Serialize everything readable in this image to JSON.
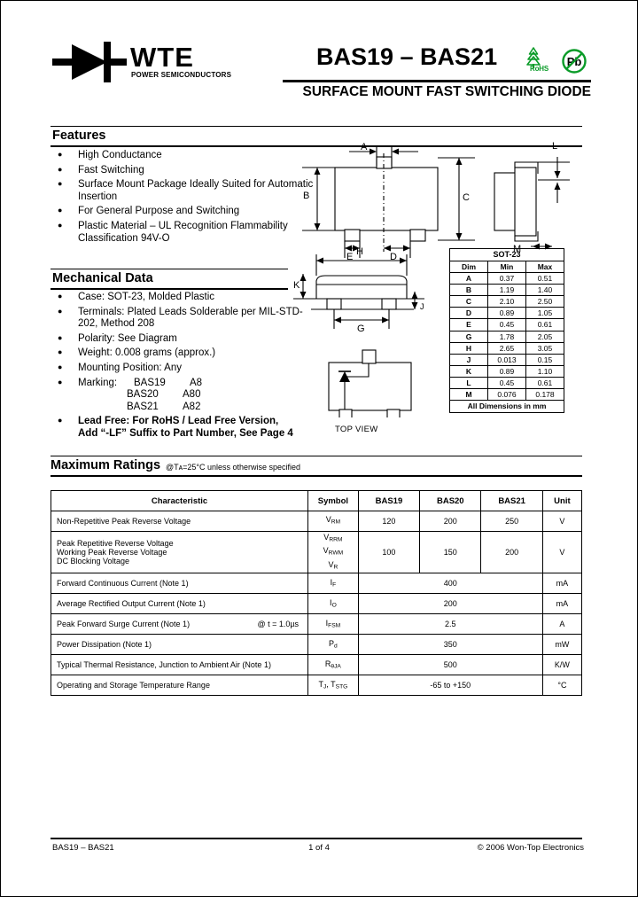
{
  "brand": {
    "name": "WTE",
    "tagline": "POWER SEMICONDUCTORS",
    "logo_icon": "diode-symbol"
  },
  "header": {
    "part_title": "BAS19 – BAS21",
    "subtitle": "SURFACE MOUNT FAST SWITCHING DIODE",
    "rohs_label": "RoHS",
    "pb_label": "Pb",
    "accent_green": "#0a9b28"
  },
  "features": {
    "heading": "Features",
    "items": [
      "High Conductance",
      "Fast Switching",
      "Surface Mount Package Ideally Suited for Automatic Insertion",
      "For General Purpose and Switching",
      "Plastic Material – UL Recognition Flammability Classification 94V-O"
    ]
  },
  "mechanical": {
    "heading": "Mechanical Data",
    "items": [
      "Case: SOT-23, Molded Plastic",
      "Terminals: Plated Leads Solderable per MIL-STD-202, Method 208",
      "Polarity: See Diagram",
      "Weight: 0.008 grams (approx.)",
      "Mounting Position: Any"
    ],
    "marking_label": "Marking:",
    "markings": [
      {
        "part": "BAS19",
        "code": "A8"
      },
      {
        "part": "BAS20",
        "code": "A80"
      },
      {
        "part": "BAS21",
        "code": "A82"
      }
    ],
    "lead_free_line1": "Lead Free: For RoHS / Lead Free Version,",
    "lead_free_line2": "Add “-LF” Suffix to Part Number, See Page 4"
  },
  "drawing": {
    "labels": [
      "A",
      "B",
      "C",
      "D",
      "E",
      "L",
      "M",
      "H",
      "K",
      "G",
      "J"
    ],
    "top_view_caption": "TOP VIEW"
  },
  "dim_table": {
    "title": "SOT-23",
    "columns": [
      "Dim",
      "Min",
      "Max"
    ],
    "rows": [
      {
        "dim": "A",
        "min": "0.37",
        "max": "0.51"
      },
      {
        "dim": "B",
        "min": "1.19",
        "max": "1.40"
      },
      {
        "dim": "C",
        "min": "2.10",
        "max": "2.50"
      },
      {
        "dim": "D",
        "min": "0.89",
        "max": "1.05"
      },
      {
        "dim": "E",
        "min": "0.45",
        "max": "0.61"
      },
      {
        "dim": "G",
        "min": "1.78",
        "max": "2.05"
      },
      {
        "dim": "H",
        "min": "2.65",
        "max": "3.05"
      },
      {
        "dim": "J",
        "min": "0.013",
        "max": "0.15"
      },
      {
        "dim": "K",
        "min": "0.89",
        "max": "1.10"
      },
      {
        "dim": "L",
        "min": "0.45",
        "max": "0.61"
      },
      {
        "dim": "M",
        "min": "0.076",
        "max": "0.178"
      }
    ],
    "footer": "All Dimensions in mm"
  },
  "ratings": {
    "heading": "Maximum Ratings",
    "condition": "@Tᴀ=25°C unless otherwise specified",
    "columns": [
      "Characteristic",
      "Symbol",
      "BAS19",
      "BAS20",
      "BAS21",
      "Unit"
    ],
    "rows": [
      {
        "characteristic": "Non-Repetitive Peak Reverse Voltage",
        "symbol_html": "V<sub>RM</sub>",
        "split": true,
        "bas19": "120",
        "bas20": "200",
        "bas21": "250",
        "unit": "V"
      },
      {
        "characteristic_lines": [
          "Peak Repetitive Reverse Voltage",
          "Working Peak Reverse Voltage",
          "DC Blocking Voltage"
        ],
        "symbol_html": "V<sub>RRM</sub><br>V<sub>RWM</sub><br>V<sub>R</sub>",
        "split": true,
        "bas19": "100",
        "bas20": "150",
        "bas21": "200",
        "unit": "V"
      },
      {
        "characteristic": "Forward Continuous Current (Note 1)",
        "symbol_html": "I<sub>F</sub>",
        "split": false,
        "value": "400",
        "unit": "mA"
      },
      {
        "characteristic": "Average Rectified Output Current (Note 1)",
        "symbol_html": "I<sub>O</sub>",
        "split": false,
        "value": "200",
        "unit": "mA"
      },
      {
        "characteristic": "Peak Forward Surge Current (Note 1)",
        "condition": "@ t = 1.0µs",
        "symbol_html": "I<sub>FSM</sub>",
        "split": false,
        "value": "2.5",
        "unit": "A"
      },
      {
        "characteristic": "Power Dissipation (Note 1)",
        "symbol_html": "P<sub>d</sub>",
        "split": false,
        "value": "350",
        "unit": "mW"
      },
      {
        "characteristic": "Typical Thermal Resistance, Junction to Ambient Air (Note 1)",
        "symbol_html": "R<sub>θJA</sub>",
        "split": false,
        "value": "500",
        "unit": "K/W"
      },
      {
        "characteristic": "Operating and Storage Temperature Range",
        "symbol_html": "T<sub>J</sub>, T<sub>STG</sub>",
        "split": false,
        "value": "-65 to +150",
        "unit": "°C"
      }
    ]
  },
  "footer": {
    "left": "BAS19 – BAS21",
    "center": "1 of 4",
    "right": "© 2006 Won-Top Electronics"
  }
}
